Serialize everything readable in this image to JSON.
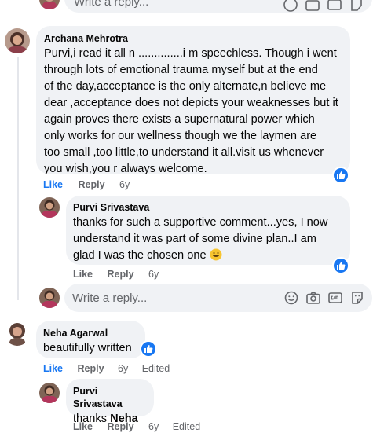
{
  "reply_placeholder": "Write a reply...",
  "comments": [
    {
      "author": "Archana Mehrotra",
      "lines": [
        "Purvi,i read it all n ..............i m speechless. Though i went",
        "through lots of emotional trauma myself but at the end",
        "of the day,acceptance is the only alternate,n believe me",
        "dear ,acceptance does not depicts your weaknesses but it",
        "again proves there exists a supernatural power which",
        "only works for our wellness though we the laymen are",
        "too small ,too little,to understand it all.visit us whenever",
        "you wish,you r always welcome."
      ],
      "like_label": "Like",
      "reply_label": "Reply",
      "age": "6y"
    },
    {
      "author": "Purvi Srivastava",
      "lines": [
        "thanks for such a supportive comment...yes, I now",
        "understand it was part of some divine plan..I am",
        "glad I was the chosen one"
      ],
      "like_label": "Like",
      "reply_label": "Reply",
      "age": "6y"
    },
    {
      "author": "Neha Agarwal",
      "lines": [
        "beautifully written"
      ],
      "like_label": "Like",
      "reply_label": "Reply",
      "age": "6y",
      "edited": "Edited"
    },
    {
      "author": "Purvi Srivastava",
      "text_prefix": "thanks ",
      "text_mention": "Neha",
      "like_label": "Like",
      "reply_label": "Reply",
      "age": "6y",
      "edited": "Edited"
    }
  ],
  "colors": {
    "bubble": "#f0f2f5",
    "like_blue": "#1877f2",
    "meta_gray": "#65676b"
  },
  "icons": [
    "thumbs-up-icon",
    "smiley-icon",
    "camera-icon",
    "gif-icon",
    "sticker-icon",
    "grinning-emoji"
  ]
}
